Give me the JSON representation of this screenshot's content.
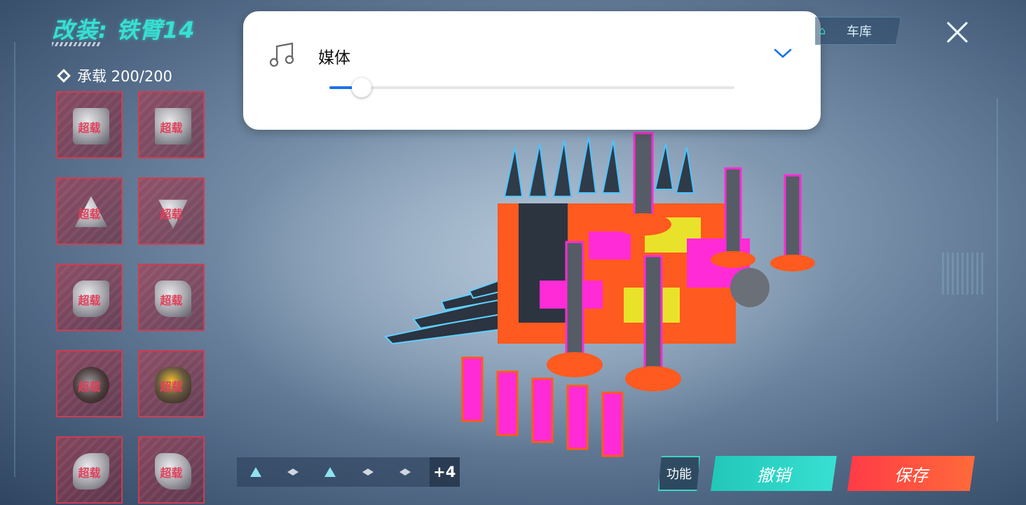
{
  "header": {
    "title": "改装: 铁臂14"
  },
  "load": {
    "label": "承载 200/200"
  },
  "parts": [
    {
      "label": "超载",
      "shape": "cube"
    },
    {
      "label": "超载",
      "shape": "plate"
    },
    {
      "label": "超载",
      "shape": "tri"
    },
    {
      "label": "超载",
      "shape": "gem"
    },
    {
      "label": "超载",
      "shape": "arm"
    },
    {
      "label": "超载",
      "shape": "arm"
    },
    {
      "label": "超载",
      "shape": "round"
    },
    {
      "label": "超载",
      "shape": "yellow"
    },
    {
      "label": "超载",
      "shape": "turbine"
    },
    {
      "label": "超载",
      "shape": "turbine"
    }
  ],
  "media": {
    "label": "媒体",
    "volume_fraction": 0.08,
    "icon": "music-note-icon",
    "accent": "#1a73e8"
  },
  "garage": {
    "label": "车库",
    "icon": "home-icon"
  },
  "close": {
    "icon": "close-icon"
  },
  "items_bar": {
    "items": [
      "triangle-icon",
      "drone-icon",
      "triangle-icon",
      "drone-icon",
      "drone-icon"
    ],
    "more": "+4"
  },
  "actions": {
    "func_label": "功能",
    "undo_label": "撤销",
    "save_label": "保存"
  },
  "colors": {
    "title": "#37e0d2",
    "undo": "#22c7b8",
    "save": "#ff3b46"
  }
}
